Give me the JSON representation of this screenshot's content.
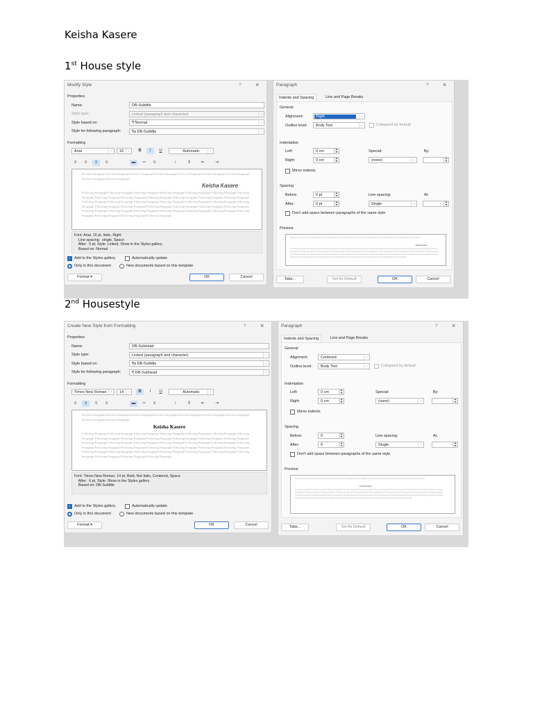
{
  "author": "Keisha Kasere",
  "heading1": {
    "num": "1",
    "sup": "st",
    "text": " House style"
  },
  "heading2": {
    "num": "2",
    "sup": "nd",
    "text": " Housestyle"
  },
  "common": {
    "help": "?",
    "close": "×",
    "properties": "Properties",
    "formatting": "Formatting",
    "name_label": "Name:",
    "type_label": "Style type:",
    "based_label": "Style based on:",
    "following_label": "Style for following paragraph:",
    "bold": "B",
    "italic": "I",
    "underline": "U",
    "add_gallery": "Add to the Styles gallery",
    "auto_update": "Automatically update",
    "only_doc": "Only in this document",
    "new_docs": "New documents based on this template",
    "format_btn": "Format ▾",
    "ok": "OK",
    "cancel": "Cancel",
    "prev_para": "Previous Paragraph Previous Paragraph Previous Paragraph Previous Paragraph Previous Paragraph Previous Paragraph Previous Paragraph Previous Paragraph Previous Paragraph",
    "follow_para": "Following Paragraph Following Paragraph Following Paragraph Following Paragraph Following Paragraph Following Paragraph Following Paragraph Following Paragraph Following Paragraph Following Paragraph Following Paragraph Following Paragraph Following Paragraph Following Paragraph Following Paragraph Following Paragraph Following Paragraph Following Paragraph Following Paragraph Following Paragraph Following Paragraph Following Paragraph Following Paragraph Following Paragraph Following Paragraph Following Paragraph Following Paragraph Following Paragraph Following Paragraph Following Paragraph Following Paragraph Following Paragraph Following Paragraph Following Paragraph Following Paragraph Following Paragraph",
    "sample": "Keisha Kasere",
    "para_title": "Paragraph",
    "tab_indents": "Indents and Spacing",
    "tab_breaks": "Line and Page Breaks",
    "general": "General",
    "alignment_label": "Alignment:",
    "outline_label": "Outline level:",
    "collapsed": "Collapsed by default",
    "indentation": "Indentation",
    "left_label": "Left:",
    "right_label": "Right:",
    "special_label": "Special:",
    "by_label": "By:",
    "mirror": "Mirror indents",
    "spacing": "Spacing",
    "before_label": "Before:",
    "after_label": "After:",
    "line_spacing_label": "Line spacing:",
    "at_label": "At:",
    "dont_add": "Don't add space between paragraphs of the same style",
    "preview": "Preview",
    "tabs_btn": "Tabs...",
    "set_default": "Set As Default"
  },
  "shot1": {
    "style": {
      "title": "Modify Style",
      "name": "DB-Subtitle",
      "type": "Linked (paragraph and character)",
      "based": "¶ Normal",
      "following": "¶a DB-Subtitle",
      "font": "Arial",
      "size": "16",
      "color": "Automatic",
      "active": "italic",
      "align": "right",
      "description": "Font: Arial, 16 pt, Italic, Right\n    Line spacing:  single, Space\n    After:  0 pt, Style: Linked, Show in the Styles gallery\n    Based on: Normal",
      "add_gallery": true,
      "auto_update": false,
      "scope": "only"
    },
    "para": {
      "alignment": "Right",
      "outline": "Body Text",
      "left": "0 cm",
      "right": "0 cm",
      "special": "(none)",
      "by": "",
      "before": "0 pt",
      "after": "0 pt",
      "line_spacing": "Single",
      "at": ""
    }
  },
  "shot2": {
    "style": {
      "title": "Create New Style from Formatting",
      "name": "DB-Subhead",
      "type": "Linked (paragraph and character)",
      "based": "¶a DB-Subtitle",
      "following": "¶ DB-Subhead",
      "font": "Times New Roman",
      "size": "14",
      "color": "Automatic",
      "active": "bold",
      "align": "center",
      "description": "Font: Times New Roman, 14 pt, Bold, Not Italic, Centered, Space\n    After:  6 pt, Style: Show in the Styles gallery\n    Based on: DB-Subtitle",
      "add_gallery": true,
      "auto_update": false,
      "scope": "only"
    },
    "para": {
      "alignment": "Centered",
      "outline": "Body Text",
      "left": "0 cm",
      "right": "0 cm",
      "special": "(none)",
      "by": "",
      "before": "0",
      "after": "6",
      "line_spacing": "Single",
      "at": ""
    }
  }
}
